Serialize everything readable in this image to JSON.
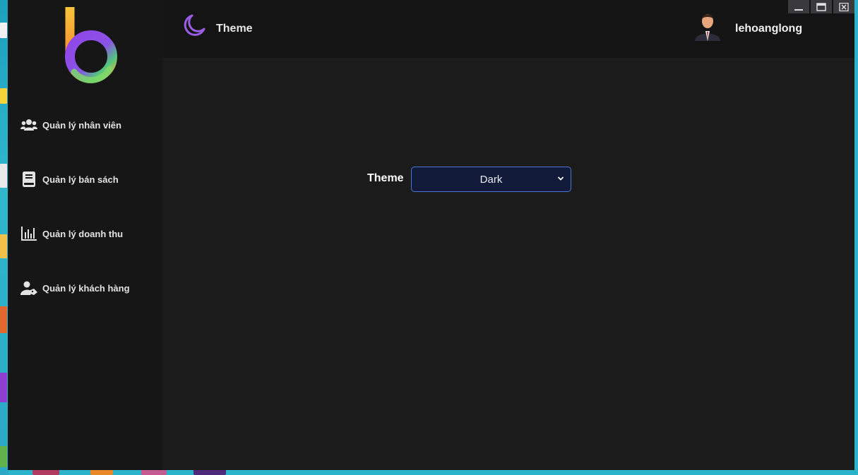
{
  "app": {
    "header_title": "Theme",
    "username": "lehoanglong"
  },
  "sidebar": {
    "items": [
      {
        "label": "Quản lý nhân viên",
        "icon": "users-icon"
      },
      {
        "label": "Quản lý bán sách",
        "icon": "book-icon"
      },
      {
        "label": "Quản lý doanh thu",
        "icon": "bar-chart-icon"
      },
      {
        "label": "Quản lý khách hàng",
        "icon": "user-tag-icon"
      }
    ]
  },
  "settings": {
    "theme_label": "Theme",
    "theme_value": "Dark"
  },
  "window_controls": [
    "minimize-icon",
    "maximize-icon",
    "close-icon"
  ],
  "colors": {
    "accent_purple": "#9b5de5",
    "select_bg": "#111b39",
    "select_border": "#4b74d6",
    "window_bg": "#1b1b1c"
  }
}
